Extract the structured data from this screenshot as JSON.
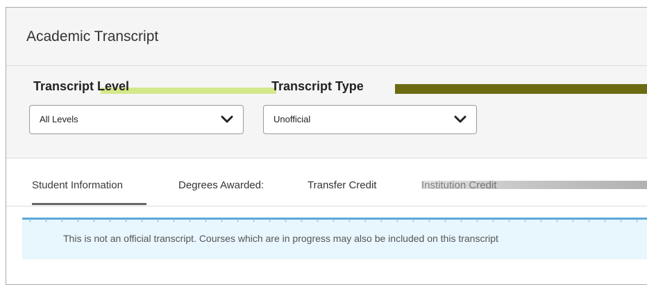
{
  "page": {
    "title": "Academic Transcript"
  },
  "filters": {
    "level_label": "Transcript Level",
    "level_value": "All Levels",
    "type_label": "Transcript Type",
    "type_value": "Unofficial"
  },
  "tabs": [
    {
      "label": "Student Information",
      "active": true
    },
    {
      "label": "Degrees Awarded:",
      "active": false
    },
    {
      "label": "Transfer Credit",
      "active": false
    },
    {
      "label": "Institution Credit",
      "active": false
    }
  ],
  "notice": {
    "text": "This is not an official transcript. Courses which are in progress may also be included on this transcript"
  },
  "icons": {
    "select_chevron": "chevron-down-icon"
  },
  "colors": {
    "page_bg": "#f5f5f5",
    "notice_bg": "#e8f6fd",
    "notice_border": "#5aa9d6",
    "active_tab_underline": "#666666"
  }
}
